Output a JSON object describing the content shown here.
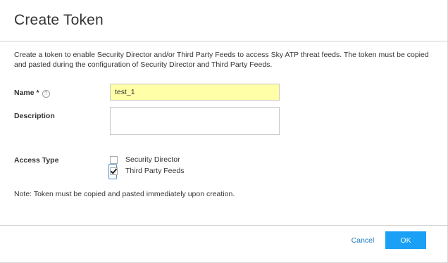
{
  "dialog": {
    "title": "Create Token",
    "intro": "Create a token to enable Security Director and/or Third Party Feeds to access Sky ATP threat feeds. The token must be copied and pasted during the configuration of Security Director and Third Party Feeds."
  },
  "form": {
    "name_label": "Name *",
    "name_help_icon": "help-circle-icon",
    "name_help_glyph": "?",
    "name_value": "test_1",
    "description_label": "Description",
    "description_value": "",
    "access_type_label": "Access Type",
    "access_options": [
      {
        "label": "Security Director",
        "checked": false
      },
      {
        "label": "Third Party Feeds",
        "checked": true
      }
    ]
  },
  "note": "Note: Token must be copied and pasted immediately upon creation.",
  "footer": {
    "cancel_label": "Cancel",
    "ok_label": "OK"
  },
  "colors": {
    "primary_button": "#1aa0f5",
    "link": "#1a7bc4",
    "name_field_highlight": "#ffffa8"
  }
}
